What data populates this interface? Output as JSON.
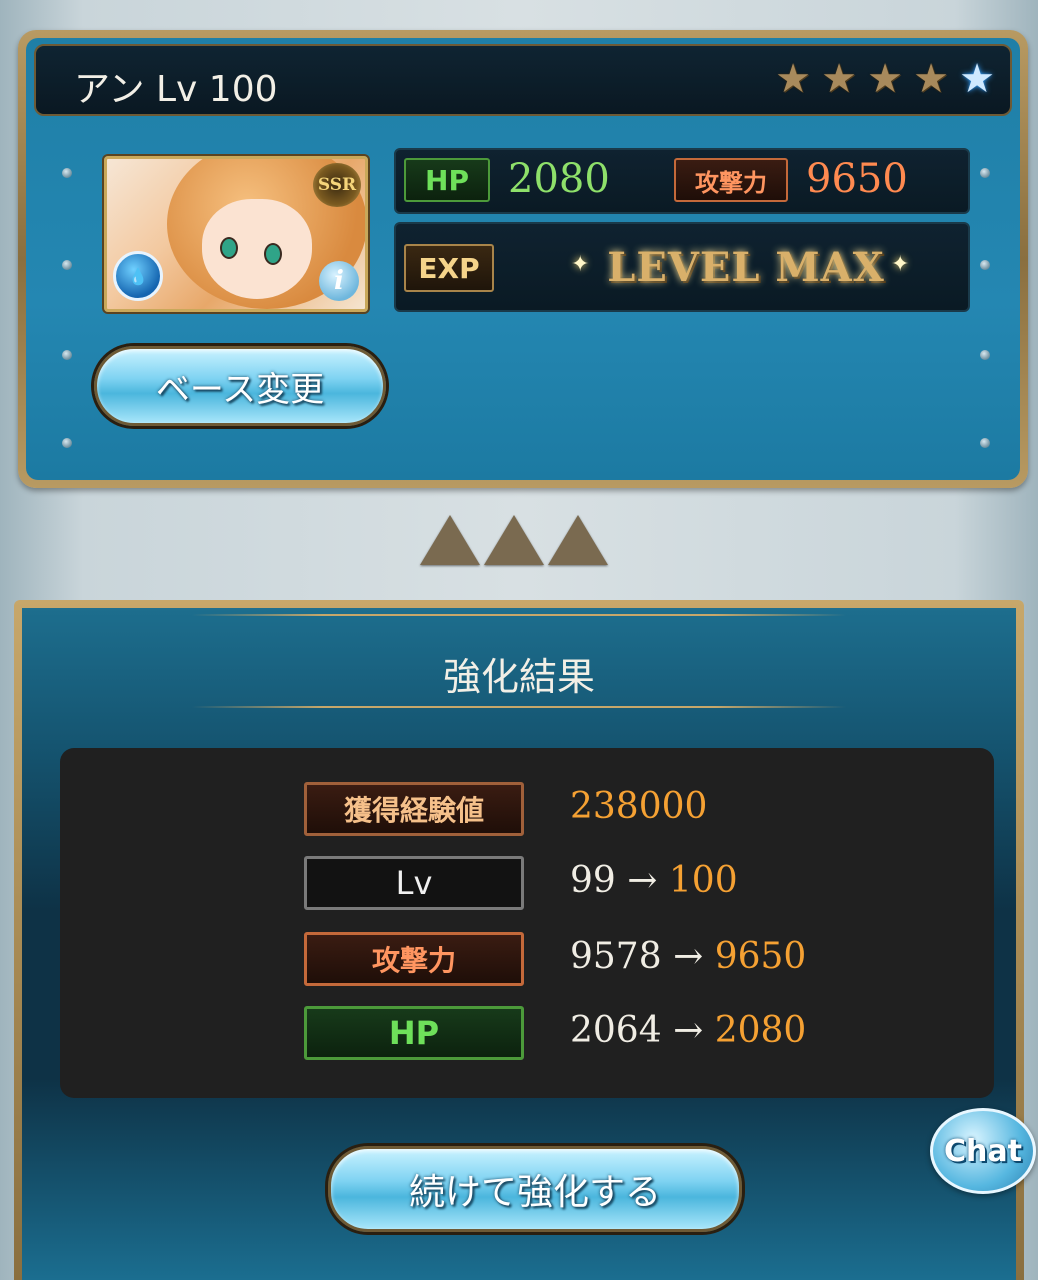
{
  "character": {
    "title": "アン Lv 100",
    "rarity": "SSR",
    "element_icon": "water-element-icon",
    "stars": {
      "filled": 4,
      "total": 5
    },
    "hp_label": "HP",
    "hp_value": "2080",
    "atk_label": "攻撃力",
    "atk_value": "9650",
    "exp_label": "EXP",
    "exp_status": "LEVEL MAX",
    "base_change_label": "ベース変更"
  },
  "result": {
    "title": "強化結果",
    "rows": [
      {
        "label": "獲得経験値",
        "before": "",
        "arrow": "",
        "after": "238000"
      },
      {
        "label": "Lv",
        "before": "99",
        "arrow": "→",
        "after": "100"
      },
      {
        "label": "攻撃力",
        "before": "9578",
        "arrow": "→",
        "after": "9650"
      },
      {
        "label": "HP",
        "before": "2064",
        "arrow": "→",
        "after": "2080"
      }
    ],
    "continue_label": "続けて強化する"
  },
  "chat": {
    "label": "Chat"
  },
  "colors": {
    "accent_orange": "#f5a133",
    "hp_green": "#6ee05a",
    "atk_orange": "#ff9560",
    "frame_gold": "#c7a76a"
  }
}
